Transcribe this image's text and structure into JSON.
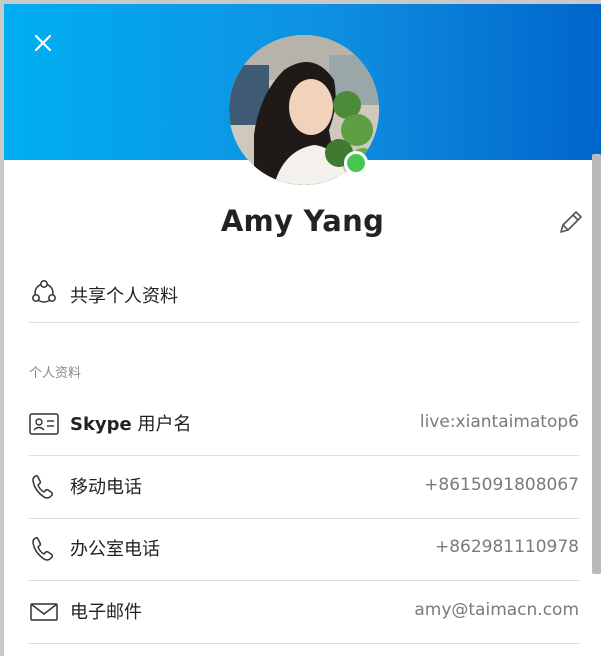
{
  "profile": {
    "display_name": "Amy Yang",
    "presence": "online",
    "presence_color": "#45c752"
  },
  "header": {
    "gradient_start": "#00aff0",
    "gradient_end": "#0066cc",
    "close_icon": "close-icon",
    "edit_icon": "pencil-icon"
  },
  "share": {
    "label": "共享个人资料",
    "icon": "share-icon"
  },
  "section": {
    "title": "个人资料"
  },
  "fields": [
    {
      "label_prefix": "Skype",
      "label": " 用户名",
      "value": "live:xiantaimatop6",
      "icon": "id-card-icon"
    },
    {
      "label": "移动电话",
      "value": "+8615091808067",
      "icon": "phone-icon"
    },
    {
      "label": "办公室电话",
      "value": "+862981110978",
      "icon": "phone-icon"
    },
    {
      "label": "电子邮件",
      "value": "amy@taimacn.com",
      "icon": "mail-icon"
    }
  ]
}
